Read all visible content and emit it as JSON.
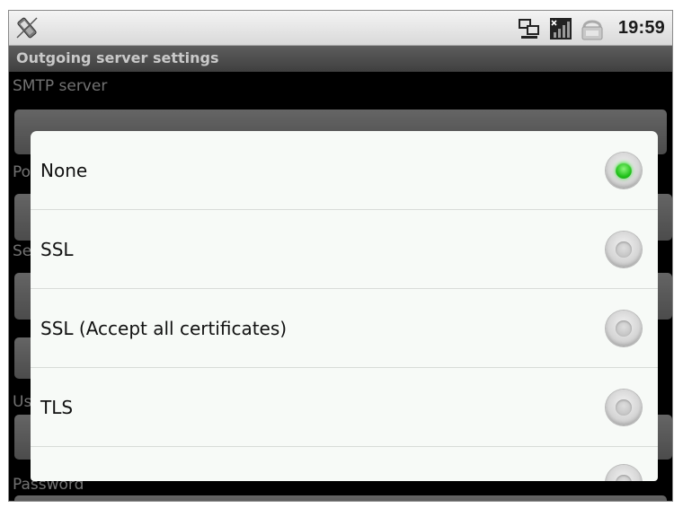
{
  "status_bar": {
    "time": "19:59",
    "icons": [
      "notification-icon",
      "network-icon",
      "signal-icon",
      "battery-icon"
    ]
  },
  "title_bar": {
    "title": "Outgoing server settings"
  },
  "form": {
    "smtp_label": "SMTP server",
    "smtp_value": "",
    "port_label": "Po",
    "security_label": "Se",
    "username_label": "Us",
    "password_label": "Password"
  },
  "dialog": {
    "options": [
      {
        "label": "None",
        "selected": true
      },
      {
        "label": "SSL",
        "selected": false
      },
      {
        "label": "SSL (Accept all certificates)",
        "selected": false
      },
      {
        "label": "TLS",
        "selected": false
      }
    ]
  },
  "colors": {
    "radio_selected": "#22c21b",
    "dialog_bg": "#f7faf7"
  }
}
